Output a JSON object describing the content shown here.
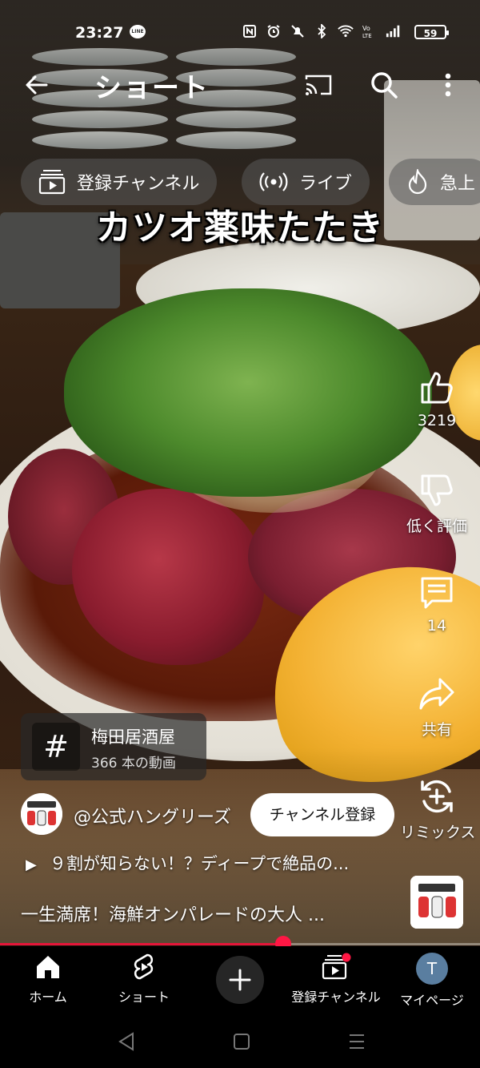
{
  "status_bar": {
    "time": "23:27",
    "line_badge": "LINE",
    "battery": "59"
  },
  "top_bar": {
    "title": "ショート"
  },
  "chips": [
    {
      "label": "登録チャンネル",
      "icon": "subscriptions-icon"
    },
    {
      "label": "ライブ",
      "icon": "live-icon"
    },
    {
      "label": "急上",
      "icon": "trending-icon"
    }
  ],
  "video": {
    "caption": "カツオ薬味たたき",
    "progress": 0.59
  },
  "actions": {
    "like_count": "3219",
    "dislike_label": "低く評価",
    "comment_count": "14",
    "share_label": "共有",
    "remix_label": "リミックス"
  },
  "tag_card": {
    "icon_glyph": "#",
    "title": "梅田居酒屋",
    "subtitle": "366 本の動画"
  },
  "channel": {
    "handle": "@公式ハングリーズ",
    "subscribe_label": "チャンネル登録"
  },
  "description": {
    "play_text": "９割が知らない！？ディープで絶品の...",
    "text": "一生満席！海鮮オンパレードの大人 ..."
  },
  "bottom_nav": {
    "home": "ホーム",
    "shorts": "ショート",
    "subscriptions": "登録チャンネル",
    "mypage": "マイページ",
    "avatar_letter": "T"
  },
  "colors": {
    "accent_red": "#ff1744",
    "chip_bg": "#5a5a5a"
  }
}
